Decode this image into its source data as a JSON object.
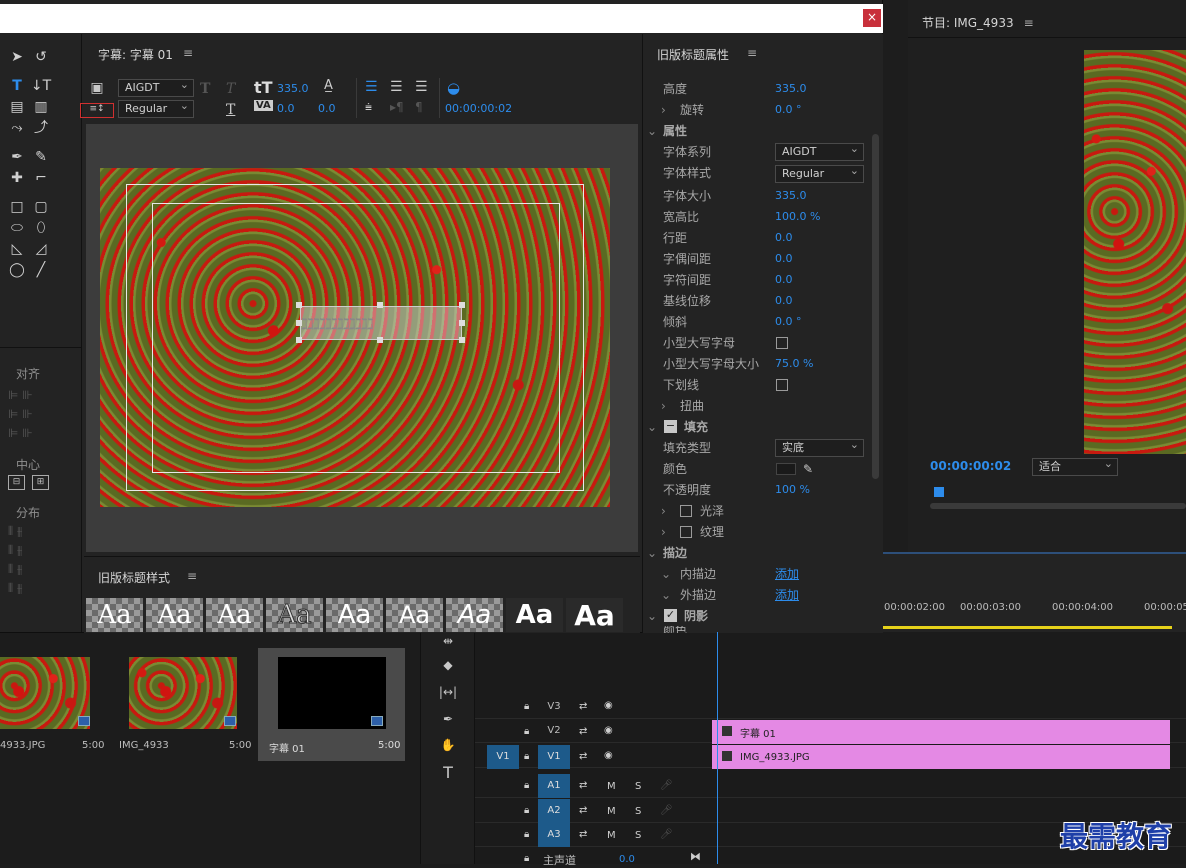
{
  "titlebar": {
    "close": "×"
  },
  "title_panel": {
    "title": "字幕: 字幕 01",
    "menu": "≡"
  },
  "toolbar": {
    "font_family": "AIGDT",
    "font_style": "Regular",
    "font_size": "335.0",
    "kerning": "0.0",
    "tracking": "0.0",
    "timecode": "00:00:00:02"
  },
  "left_tools": {
    "align_label": "对齐",
    "center_label": "中心",
    "distribute_label": "分布"
  },
  "properties_panel": {
    "title": "旧版标题属性",
    "rows": [
      {
        "label": "高度",
        "value": "335.0"
      },
      {
        "label": "旋转",
        "value": "0.0 °"
      },
      {
        "label": "属性",
        "value": ""
      },
      {
        "label": "字体系列",
        "value": "AIGDT"
      },
      {
        "label": "字体样式",
        "value": "Regular"
      },
      {
        "label": "字体大小",
        "value": "335.0"
      },
      {
        "label": "宽高比",
        "value": "100.0 %"
      },
      {
        "label": "行距",
        "value": "0.0"
      },
      {
        "label": "字偶间距",
        "value": "0.0"
      },
      {
        "label": "字符间距",
        "value": "0.0"
      },
      {
        "label": "基线位移",
        "value": "0.0"
      },
      {
        "label": "倾斜",
        "value": "0.0 °"
      },
      {
        "label": "小型大写字母",
        "value": ""
      },
      {
        "label": "小型大写字母大小",
        "value": "75.0 %"
      },
      {
        "label": "下划线",
        "value": ""
      },
      {
        "label": "扭曲",
        "value": ""
      },
      {
        "label": "填充",
        "value": ""
      },
      {
        "label": "填充类型",
        "value": "实底"
      },
      {
        "label": "颜色",
        "value": ""
      },
      {
        "label": "不透明度",
        "value": "100 %"
      },
      {
        "label": "光泽",
        "value": ""
      },
      {
        "label": "纹理",
        "value": ""
      },
      {
        "label": "描边",
        "value": ""
      },
      {
        "label": "内描边",
        "value": "添加"
      },
      {
        "label": "外描边",
        "value": "添加"
      },
      {
        "label": "阴影",
        "value": ""
      },
      {
        "label": "颜色",
        "value": ""
      }
    ]
  },
  "styles_panel": {
    "title": "旧版标题样式",
    "sample": "Aa"
  },
  "program_monitor": {
    "title": "节目: IMG_4933",
    "timecode": "00:00:00:02",
    "fit": "适合"
  },
  "timeline": {
    "ticks": [
      "00:00:02:00",
      "00:00:03:00",
      "00:00:04:00",
      "00:00:05"
    ],
    "tracks": [
      {
        "name": "V3",
        "source": ""
      },
      {
        "name": "V2",
        "source": ""
      },
      {
        "name": "V1",
        "source": "V1"
      },
      {
        "name": "A1",
        "source": ""
      },
      {
        "name": "A2",
        "source": ""
      },
      {
        "name": "A3",
        "source": ""
      }
    ],
    "master": "主声道",
    "master_val": "0.0",
    "clips": [
      {
        "name": "字幕 01"
      },
      {
        "name": "IMG_4933.JPG"
      }
    ],
    "m": "M",
    "s": "S"
  },
  "project_bin": {
    "items": [
      {
        "name": "4933.JPG",
        "dur": "5:00"
      },
      {
        "name": "IMG_4933",
        "dur": "5:00"
      },
      {
        "name": "字幕 01",
        "dur": "5:00"
      }
    ]
  },
  "watermark": "最需教育",
  "colors": {
    "accent": "#2d8ceb",
    "clip": "#e489e4",
    "playhead": "#2d8ceb",
    "yellow_bar": "#e6d21a"
  }
}
